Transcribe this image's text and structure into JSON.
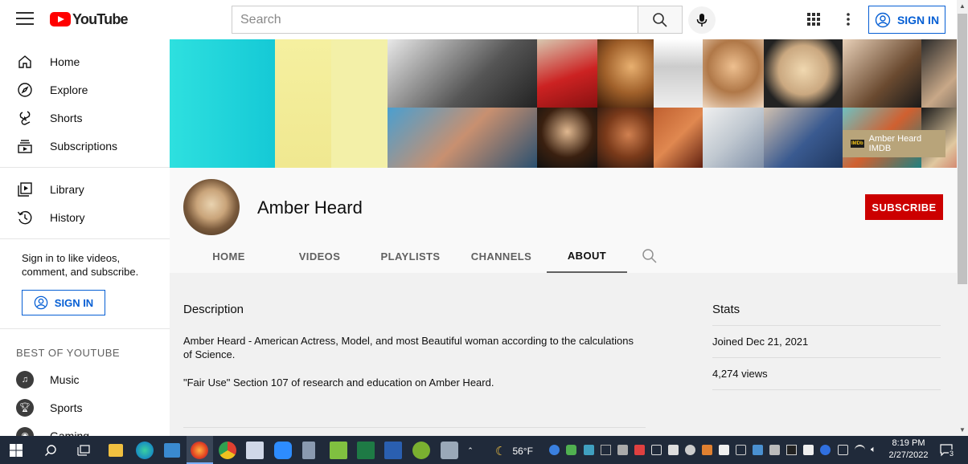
{
  "header": {
    "logo_text": "YouTube",
    "search_placeholder": "Search",
    "sign_in_label": "SIGN IN"
  },
  "sidebar": {
    "primary": [
      {
        "label": "Home",
        "icon": "home-icon"
      },
      {
        "label": "Explore",
        "icon": "compass-icon"
      },
      {
        "label": "Shorts",
        "icon": "shorts-icon"
      },
      {
        "label": "Subscriptions",
        "icon": "subscriptions-icon"
      }
    ],
    "secondary": [
      {
        "label": "Library",
        "icon": "library-icon"
      },
      {
        "label": "History",
        "icon": "history-icon"
      }
    ],
    "signin_note": "Sign in to like videos, comment, and subscribe.",
    "signin_button": "SIGN IN",
    "best_title": "BEST OF YOUTUBE",
    "best": [
      {
        "label": "Music",
        "icon": "music-icon"
      },
      {
        "label": "Sports",
        "icon": "trophy-icon"
      },
      {
        "label": "Gaming",
        "icon": "gamepad-icon"
      }
    ]
  },
  "banner": {
    "link_label": "Amber Heard IMDB",
    "link_badge": "IMDb"
  },
  "channel": {
    "name": "Amber Heard",
    "subscribe_label": "SUBSCRIBE",
    "tabs": [
      "HOME",
      "VIDEOS",
      "PLAYLISTS",
      "CHANNELS",
      "ABOUT"
    ],
    "active_tab": "ABOUT"
  },
  "about": {
    "description_title": "Description",
    "description_lines": [
      "Amber Heard - American Actress, Model, and most Beautiful woman according to the calculations of Science.",
      "\"Fair Use\" Section 107 of research and education on Amber Heard."
    ],
    "stats_title": "Stats",
    "joined": "Joined Dec 21, 2021",
    "views": "4,274 views"
  },
  "taskbar": {
    "weather": "56°F",
    "time": "8:19 PM",
    "date": "2/27/2022",
    "notifications": "3"
  },
  "colors": {
    "brand_red": "#ff0000",
    "subscribe_red": "#cc0000",
    "link_blue": "#065fd4"
  }
}
